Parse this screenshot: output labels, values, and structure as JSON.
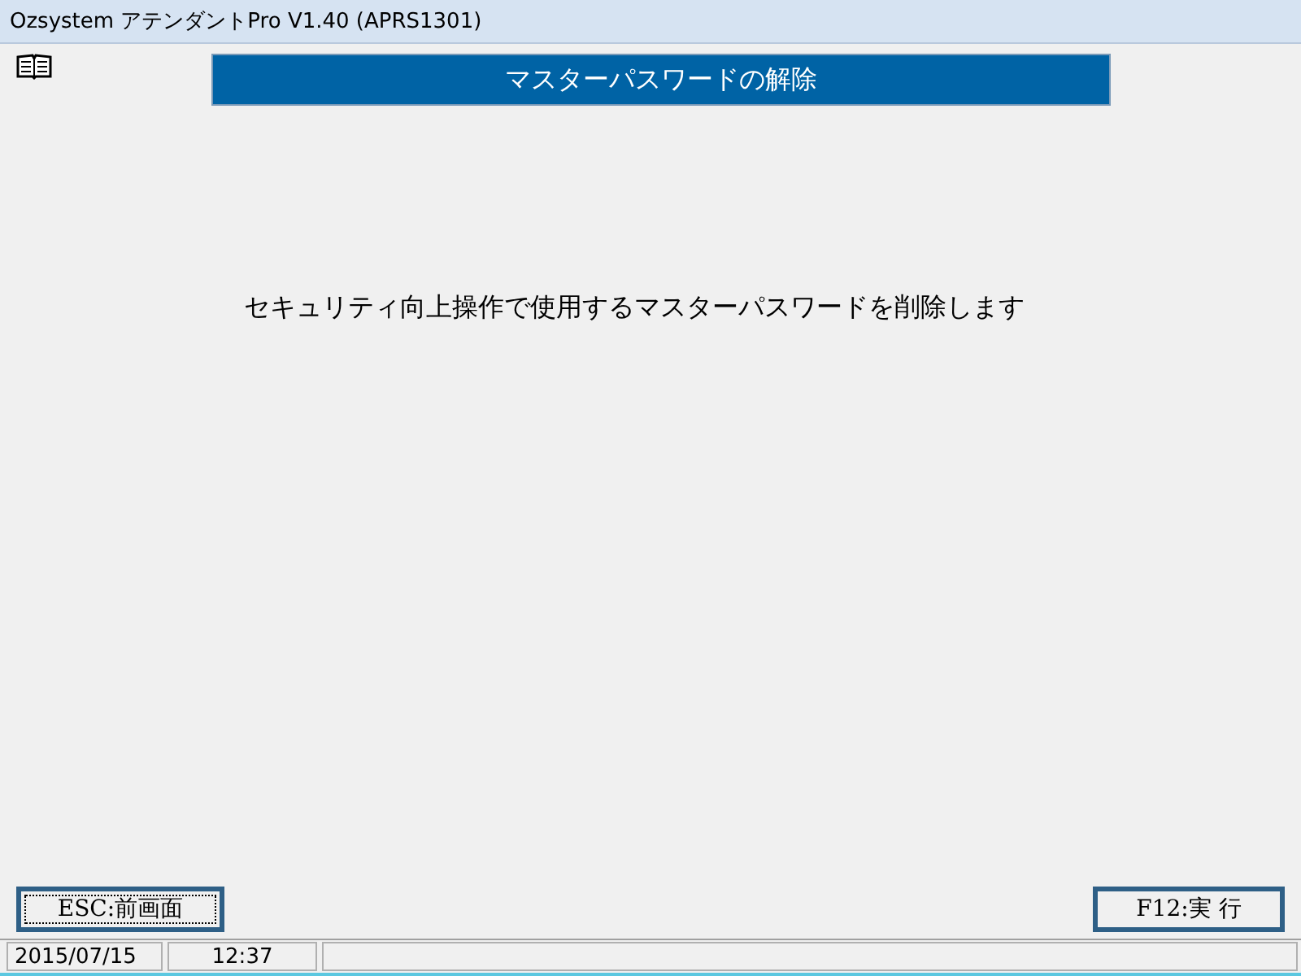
{
  "window": {
    "title": "Ozsystem アテンダントPro V1.40 (APRS1301)"
  },
  "header": {
    "title": "マスターパスワードの解除"
  },
  "message": "セキュリティ向上操作で使用するマスターパスワードを削除します",
  "buttons": [
    {
      "label": "ESC:前画面",
      "focused": true
    },
    {
      "label": "F12:実 行",
      "focused": false
    }
  ],
  "status_bar": {
    "date": "2015/07/15",
    "time": "12:37"
  }
}
